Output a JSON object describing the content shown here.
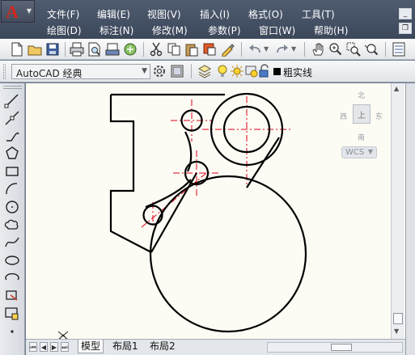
{
  "menu_rows": [
    [
      "文件(F)",
      "编辑(E)",
      "视图(V)",
      "插入(I)",
      "格式(O)",
      "工具(T)"
    ],
    [
      "绘图(D)",
      "标注(N)",
      "修改(M)",
      "参数(P)",
      "窗口(W)",
      "帮助(H)"
    ]
  ],
  "app": {
    "logo_icon": "autocad-logo-icon"
  },
  "toolbar": {
    "workspace_value": "AutoCAD 经典",
    "linetype_value": "粗实线"
  },
  "viewcube": {
    "north": "北",
    "south": "南",
    "east": "东",
    "west": "西",
    "face": "上",
    "wcs": "WCS"
  },
  "layout_tabs": [
    "模型",
    "布局1",
    "布局2"
  ],
  "colors": {
    "canvas_background": "#fdfcf4",
    "geometry_stroke": "#000000",
    "centerline": "#e0001a",
    "title_background": "#46526a",
    "menu_text": "#ffffff"
  },
  "left_tools": [
    "line-icon",
    "construction-line-icon",
    "polyline-icon",
    "polygon-icon",
    "rectangle-icon",
    "arc-icon",
    "circle-icon",
    "revision-cloud-icon",
    "spline-icon",
    "ellipse-icon",
    "ellipse-arc-icon",
    "insert-block-icon",
    "make-block-icon",
    "point-icon"
  ]
}
